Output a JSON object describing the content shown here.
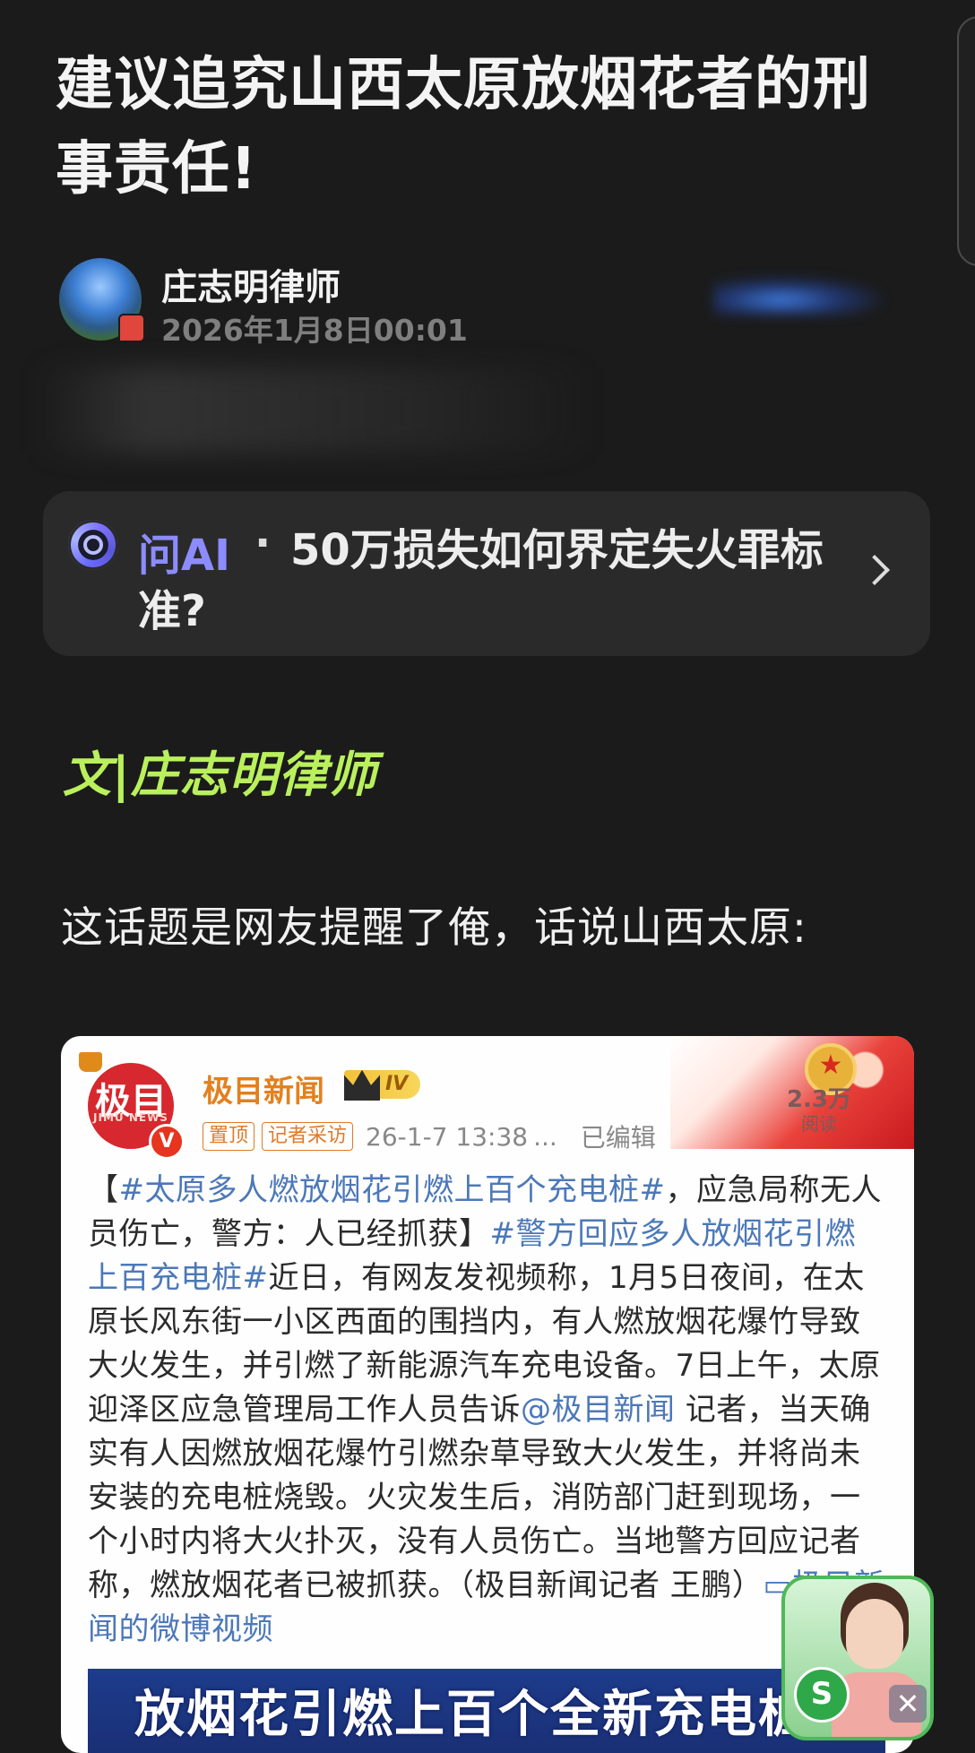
{
  "article": {
    "title": "建议追究山西太原放烟花者的刑事责任!",
    "author": "庄志明律师",
    "date": "2026年1月8日00:01"
  },
  "ask_ai": {
    "label": "问AI",
    "separator": "·",
    "question": "50万损失如何界定失火罪标准?"
  },
  "content": {
    "byline": "文|庄志明律师",
    "intro": "这话题是网友提醒了俺，话说山西太原:"
  },
  "weibo_post": {
    "logo_text": "极目",
    "logo_sub": "JIMU NEWS",
    "verify_mark": "V",
    "account": "极目新闻",
    "vip_level": "IV",
    "tag_pin": "置顶",
    "tag_interview": "记者采访",
    "time": "26-1-7 13:38",
    "ellipsis": "...",
    "edited": "已编辑",
    "read_count": "2.3万",
    "read_label": "阅读",
    "body": {
      "p1": "【",
      "link1": "#太原多人燃放烟花引燃上百个充电桩#",
      "p2": "，应急局称无人员伤亡，警方：人已经抓获】",
      "link2": "#警方回应多人放烟花引燃上百充电桩#",
      "p3": "近日，有网友发视频称，1月5日夜间，在太原长风东街一小区西面的围挡内，有人燃放烟花爆竹导致大火发生，并引燃了新能源汽车充电设备。7日上午，太原迎泽区应急管理局工作人员告诉",
      "link3": "@极目新闻",
      "p4": " 记者，当天确实有人因燃放烟花爆竹引燃杂草导致大火发生，并将尚未安装的充电桩烧毁。火灾发生后，消防部门赶到现场，一个小时内将大火扑灭，没有人员伤亡。当地警方回应记者称，燃放烟花者已被抓获。（极目新闻记者 王鹏）",
      "link4": "▭极目新闻的微博视频"
    },
    "image_caption": "放烟花引燃上百个全新充电桩"
  },
  "assistant": {
    "logo_text": "S",
    "close": "✕"
  }
}
